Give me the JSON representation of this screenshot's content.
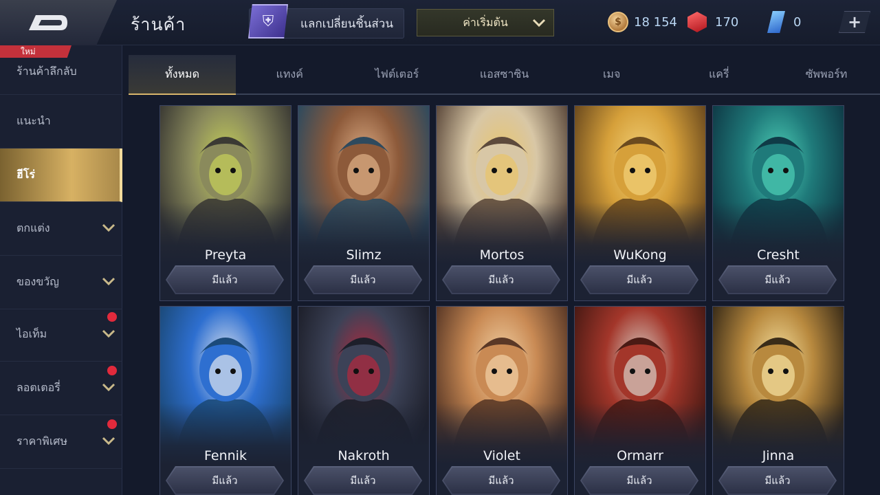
{
  "header": {
    "title": "ร้านค้า",
    "exchange_label": "แลกเปลี่ยนชิ้นส่วน",
    "sort_label": "ค่าเริ่มต้น",
    "currencies": [
      {
        "name": "gold",
        "value": "18 154",
        "color": "#d9a35b"
      },
      {
        "name": "ruby",
        "value": "170",
        "color": "#e23b3b"
      },
      {
        "name": "voucher",
        "value": "0",
        "color": "#4aa3ff"
      }
    ],
    "add_label": "+"
  },
  "sidebar": {
    "badge": "ใหม่",
    "items": [
      {
        "label": "ร้านค้าลึกลับ",
        "chevron": false,
        "dot": false
      },
      {
        "label": "แนะนำ",
        "chevron": false,
        "dot": false
      },
      {
        "label": "ฮีโร่",
        "chevron": false,
        "dot": false,
        "active": true
      },
      {
        "label": "ตกแต่ง",
        "chevron": true,
        "dot": false
      },
      {
        "label": "ของขวัญ",
        "chevron": true,
        "dot": false
      },
      {
        "label": "ไอเท็ม",
        "chevron": true,
        "dot": true
      },
      {
        "label": "ลอตเตอรี่",
        "chevron": true,
        "dot": true
      },
      {
        "label": "ราคาพิเศษ",
        "chevron": true,
        "dot": true
      }
    ]
  },
  "tabs": [
    "ทั้งหมด",
    "แทงค์",
    "ไฟต์เตอร์",
    "แอสซาซิน",
    "เมจ",
    "แครี่",
    "ซัพพอร์ท"
  ],
  "active_tab": 0,
  "heroes": [
    {
      "name": "Preyta",
      "status": "มีแล้ว",
      "palette": [
        "#3b3a34",
        "#8a8a5c",
        "#c7d25a"
      ]
    },
    {
      "name": "Slimz",
      "status": "มีแล้ว",
      "palette": [
        "#2e4a5e",
        "#8d5a3a",
        "#e0b088"
      ]
    },
    {
      "name": "Mortos",
      "status": "มีแล้ว",
      "palette": [
        "#5d4a3c",
        "#d8c7a6",
        "#e9c46a"
      ]
    },
    {
      "name": "WuKong",
      "status": "มีแล้ว",
      "palette": [
        "#6b4a1e",
        "#d6a03a",
        "#f2d27a"
      ]
    },
    {
      "name": "Cresht",
      "status": "มีแล้ว",
      "palette": [
        "#0f3b47",
        "#1f7a7a",
        "#4fd1b8"
      ]
    },
    {
      "name": "Fennik",
      "status": "มีแล้ว",
      "palette": [
        "#1b4a7a",
        "#2e6fd0",
        "#e0e6f0"
      ]
    },
    {
      "name": "Nakroth",
      "status": "มีแล้ว",
      "palette": [
        "#1d1f2a",
        "#3c4257",
        "#b5283c"
      ]
    },
    {
      "name": "Violet",
      "status": "มีแล้ว",
      "palette": [
        "#5a3826",
        "#c98a54",
        "#f2d2a6"
      ]
    },
    {
      "name": "Ormarr",
      "status": "มีแล้ว",
      "palette": [
        "#4a1a14",
        "#a3362a",
        "#d9d0c7"
      ]
    },
    {
      "name": "Jinna",
      "status": "มีแล้ว",
      "palette": [
        "#3a2c18",
        "#b8893e",
        "#f6e2a2"
      ]
    }
  ]
}
